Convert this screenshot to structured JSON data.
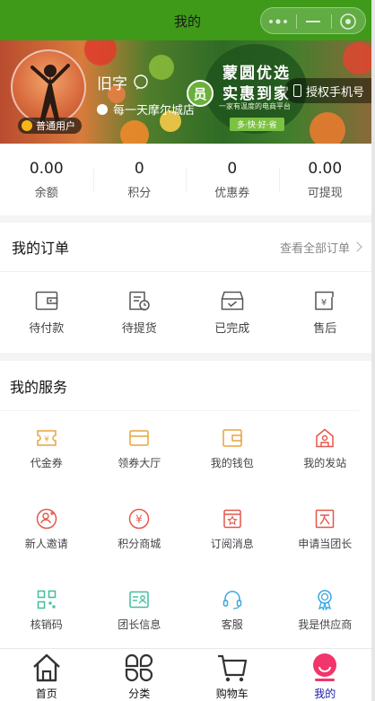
{
  "nav": {
    "title": "我的"
  },
  "profile": {
    "username": "旧字",
    "store": "每一天摩尔城店",
    "level_badge": "普通用户",
    "auth_button": "授权手机号"
  },
  "banner": {
    "line1": "蒙圆优选",
    "line2": "实惠到家",
    "sub": "一家有温度的电商平台",
    "tag": "多·快·好·省",
    "seal": "员"
  },
  "stats": [
    {
      "value": "0.00",
      "label": "余额"
    },
    {
      "value": "0",
      "label": "积分"
    },
    {
      "value": "0",
      "label": "优惠券"
    },
    {
      "value": "0.00",
      "label": "可提现"
    }
  ],
  "orders": {
    "title": "我的订单",
    "more": "查看全部订单",
    "items": [
      {
        "label": "待付款",
        "icon": "wallet-icon"
      },
      {
        "label": "待提货",
        "icon": "pickup-icon"
      },
      {
        "label": "已完成",
        "icon": "completed-box-icon"
      },
      {
        "label": "售后",
        "icon": "after-sale-icon"
      }
    ]
  },
  "services": {
    "title": "我的服务",
    "items": [
      {
        "label": "代金券",
        "icon": "voucher-icon",
        "color": "#e8a43a"
      },
      {
        "label": "领券大厅",
        "icon": "coupon-hall-icon",
        "color": "#e8a43a"
      },
      {
        "label": "我的钱包",
        "icon": "wallet-icon",
        "color": "#e8a43a"
      },
      {
        "label": "我的发站",
        "icon": "station-icon",
        "color": "#e4574a"
      },
      {
        "label": "新人邀请",
        "icon": "invite-icon",
        "color": "#e4574a"
      },
      {
        "label": "积分商城",
        "icon": "points-mall-icon",
        "color": "#e4574a"
      },
      {
        "label": "订阅消息",
        "icon": "subscribe-icon",
        "color": "#e4574a"
      },
      {
        "label": "申请当团长",
        "icon": "apply-leader-icon",
        "color": "#e4574a"
      },
      {
        "label": "核销码",
        "icon": "qr-code-icon",
        "color": "#3fbf9b"
      },
      {
        "label": "团长信息",
        "icon": "leader-info-icon",
        "color": "#3fbf9b"
      },
      {
        "label": "客服",
        "icon": "headset-icon",
        "color": "#3aa7e0"
      },
      {
        "label": "我是供应商",
        "icon": "supplier-badge-icon",
        "color": "#3aa7e0"
      }
    ]
  },
  "tabbar": [
    {
      "label": "首页",
      "icon": "home-icon",
      "active": false
    },
    {
      "label": "分类",
      "icon": "category-icon",
      "active": false
    },
    {
      "label": "购物车",
      "icon": "cart-icon",
      "active": false
    },
    {
      "label": "我的",
      "icon": "profile-icon",
      "active": true
    }
  ],
  "colors": {
    "nav_bg": "#3f9a1a",
    "active_tab": "#1a1aa8",
    "profile_icon": "#f2356b"
  }
}
